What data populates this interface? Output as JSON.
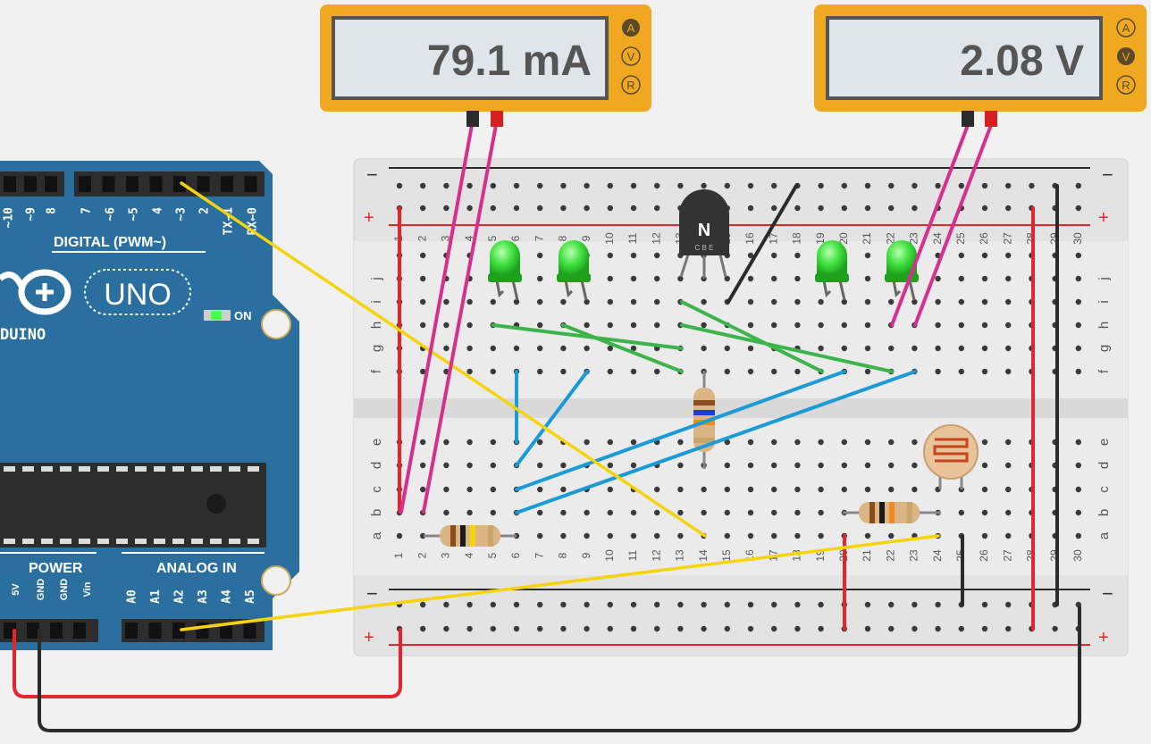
{
  "meters": [
    {
      "display": "79.1 mA",
      "modes": [
        "A",
        "V",
        "R"
      ],
      "active": "A"
    },
    {
      "display": "2.08 V",
      "modes": [
        "A",
        "V",
        "R"
      ],
      "active": "V"
    }
  ],
  "arduino": {
    "model": "UNO",
    "brand_fragment": "DUINO",
    "on_label": "ON",
    "digital_label": "DIGITAL (PWM~)",
    "digital_pins": [
      "~10",
      "~9",
      "8",
      "7",
      "~6",
      "~5",
      "4",
      "~3",
      "2",
      "TX→1",
      "RX←0"
    ],
    "power_label": "POWER",
    "analog_label": "ANALOG IN",
    "power_pins": [
      "5V",
      "GND",
      "GND",
      "Vin"
    ],
    "analog_pins": [
      "A0",
      "A1",
      "A2",
      "A3",
      "A4",
      "A5"
    ]
  },
  "breadboard": {
    "rail_minus": "−",
    "rail_plus": "+",
    "columns": [
      "1",
      "2",
      "3",
      "4",
      "5",
      "6",
      "7",
      "8",
      "9",
      "10",
      "11",
      "12",
      "13",
      "14",
      "15",
      "16",
      "17",
      "18",
      "19",
      "20",
      "21",
      "22",
      "23",
      "24",
      "25",
      "26",
      "27",
      "28",
      "29",
      "30"
    ],
    "rows_top": [
      "j",
      "i",
      "h",
      "g",
      "f"
    ],
    "rows_bottom": [
      "e",
      "d",
      "c",
      "b",
      "a"
    ]
  },
  "transistor": {
    "label": "N",
    "pins": "C B E"
  },
  "colors": {
    "board_blue": "#2a6fa0",
    "meter_orange": "#f0a820",
    "wire_red": "#e3262b",
    "wire_black": "#2b2b2b",
    "wire_yellow": "#f5d40e",
    "wire_pink": "#d62f8f",
    "wire_green": "#3cb44b",
    "wire_blue": "#1a9ad6",
    "led_green": "#3ee03e"
  }
}
